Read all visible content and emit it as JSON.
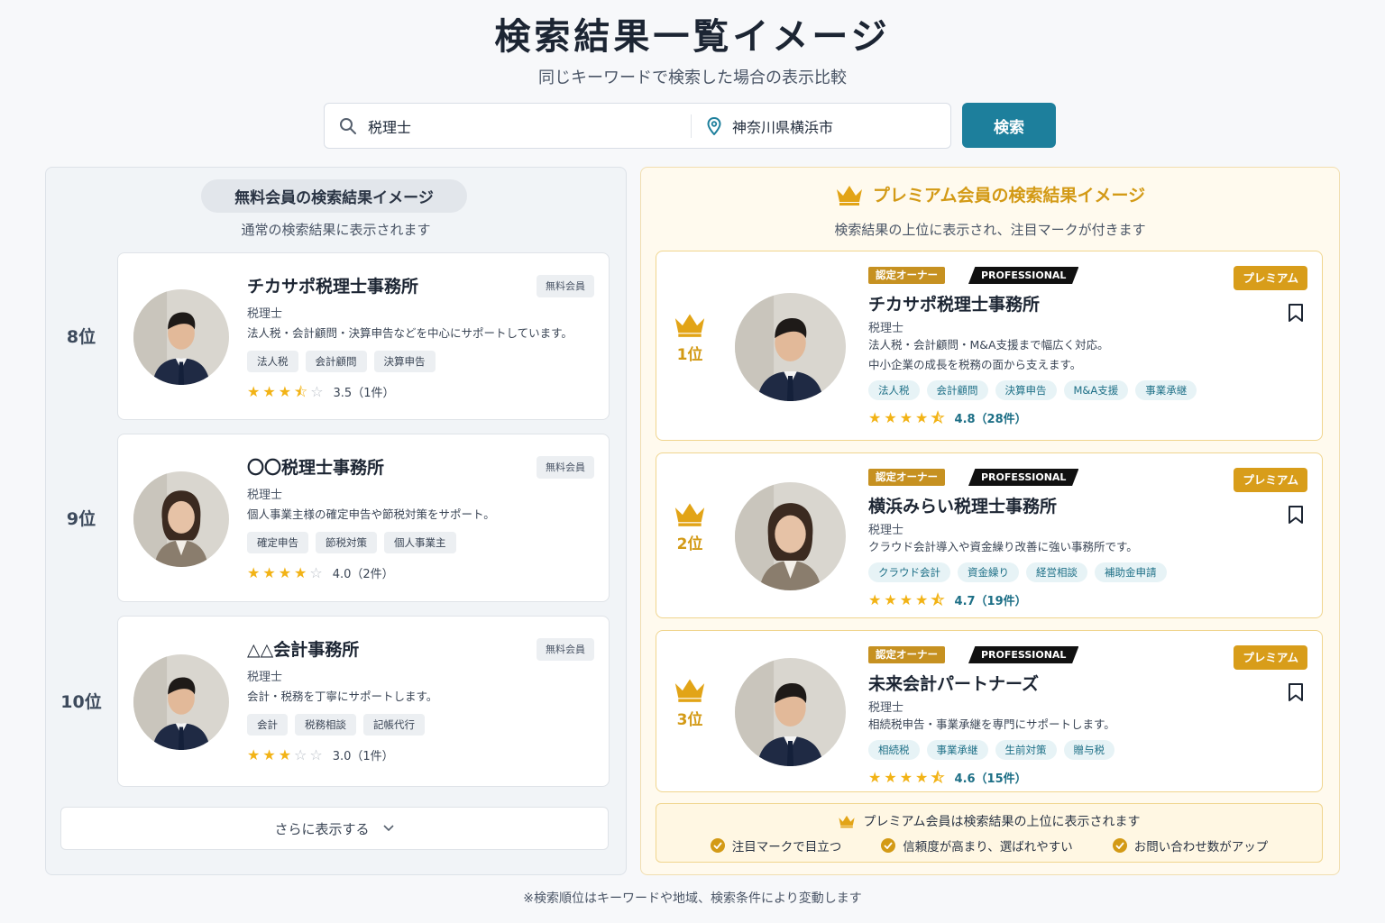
{
  "header": {
    "title": "検索結果一覧イメージ",
    "subtitle": "同じキーワードで検索した場合の表示比較"
  },
  "search": {
    "keyword": "税理士",
    "location": "神奈川県横浜市",
    "button_label": "検索"
  },
  "free_panel": {
    "heading": "無料会員の検索結果イメージ",
    "subheading": "通常の検索結果に表示されます",
    "badge_label": "無料会員",
    "more_label": "さらに表示する",
    "cards": [
      {
        "rank": "8位",
        "name": "チカサポ税理士事務所",
        "type": "税理士",
        "desc": "法人税・会計顧問・決算申告などを中心にサポートしています。",
        "tags": [
          "法人税",
          "会計顧問",
          "決算申告"
        ],
        "rating": 3.5,
        "rating_text": "3.5（1件）"
      },
      {
        "rank": "9位",
        "name": "〇〇税理士事務所",
        "type": "税理士",
        "desc": "個人事業主様の確定申告や節税対策をサポート。",
        "tags": [
          "確定申告",
          "節税対策",
          "個人事業主"
        ],
        "rating": 4.0,
        "rating_text": "4.0（2件）"
      },
      {
        "rank": "10位",
        "name": "△△会計事務所",
        "type": "税理士",
        "desc": "会計・税務を丁寧にサポートします。",
        "tags": [
          "会計",
          "税務相談",
          "記帳代行"
        ],
        "rating": 3.0,
        "rating_text": "3.0（1件）"
      }
    ]
  },
  "premium_panel": {
    "heading": "プレミアム会員の検索結果イメージ",
    "subheading": "検索結果の上位に表示され、注目マークが付きます",
    "badge_label": "プレミアム",
    "owner_label": "認定オーナー",
    "pro_label": "PROFESSIONAL",
    "cards": [
      {
        "rank": "1位",
        "name": "チカサポ税理士事務所",
        "type": "税理士",
        "desc_lines": [
          "法人税・会計顧問・M&A支援まで幅広く対応。",
          "中小企業の成長を税務の面から支えます。"
        ],
        "tags": [
          "法人税",
          "会計顧問",
          "決算申告",
          "M&A支援",
          "事業承継"
        ],
        "rating": 4.8,
        "rating_text": "4.8（28件）"
      },
      {
        "rank": "2位",
        "name": "横浜みらい税理士事務所",
        "type": "税理士",
        "desc_lines": [
          "クラウド会計導入や資金繰り改善に強い事務所です。"
        ],
        "tags": [
          "クラウド会計",
          "資金繰り",
          "経営相談",
          "補助金申請"
        ],
        "rating": 4.7,
        "rating_text": "4.7（19件）"
      },
      {
        "rank": "3位",
        "name": "未来会計パートナーズ",
        "type": "税理士",
        "desc_lines": [
          "相続税申告・事業承継を専門にサポートします。"
        ],
        "tags": [
          "相続税",
          "事業承継",
          "生前対策",
          "贈与税"
        ],
        "rating": 4.6,
        "rating_text": "4.6（15件）"
      }
    ],
    "info": {
      "title": "プレミアム会員は検索結果の上位に表示されます",
      "points": [
        "注目マークで目立つ",
        "信頼度が高まり、選ばれやすい",
        "お問い合わせ数がアップ"
      ]
    }
  },
  "footnote": "※検索順位はキーワードや地域、検索条件により変動します",
  "colors": {
    "accent": "#1d7f9c",
    "premium_gold": "#d39a16",
    "star": "#f2b316"
  }
}
